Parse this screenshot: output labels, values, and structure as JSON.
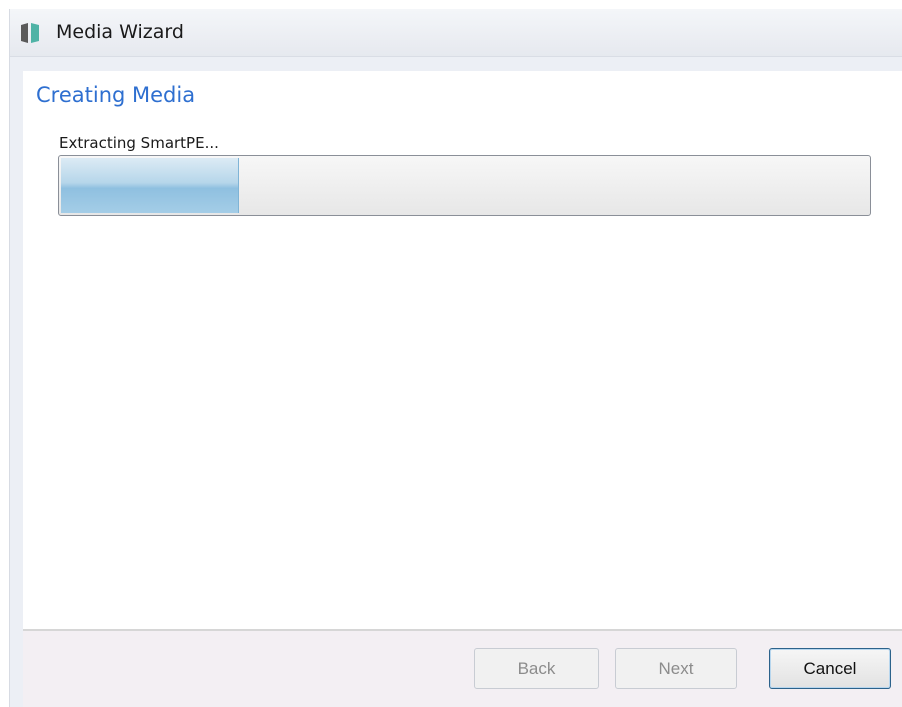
{
  "window": {
    "title": "Media Wizard",
    "icon": "media-wizard-app-icon"
  },
  "page": {
    "title": "Creating Media",
    "status": "Extracting SmartPE..."
  },
  "progress": {
    "fraction": 0.22
  },
  "buttons": {
    "back": {
      "label": "Back",
      "enabled": false
    },
    "next": {
      "label": "Next",
      "enabled": false
    },
    "cancel": {
      "label": "Cancel",
      "enabled": true
    }
  },
  "colors": {
    "title_accent": "#2e6fd0",
    "progress_fill": "#a4cde7"
  }
}
